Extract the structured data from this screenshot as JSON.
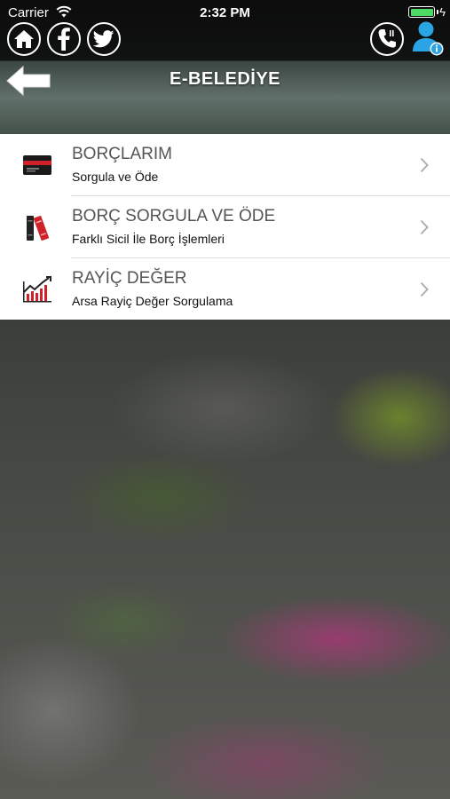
{
  "status_bar": {
    "carrier": "Carrier",
    "time": "2:32 PM"
  },
  "top_icons": {
    "left": [
      "home-icon",
      "facebook-icon",
      "twitter-icon"
    ],
    "right": [
      "phone-icon",
      "user-info-icon"
    ]
  },
  "header": {
    "title": "E-BELEDİYE"
  },
  "menu": {
    "items": [
      {
        "title": "BORÇLARIM",
        "subtitle": "Sorgula ve Öde",
        "icon": "credit-card-icon"
      },
      {
        "title": "BORÇ SORGULA VE ÖDE",
        "subtitle": "Farklı Sicil İle Borç İşlemleri",
        "icon": "books-icon"
      },
      {
        "title": "RAYİÇ DEĞER",
        "subtitle": "Arsa Rayiç Değer Sorgulama",
        "icon": "chart-icon"
      }
    ]
  },
  "colors": {
    "accent_red": "#d0202a",
    "battery_green": "#4cd964",
    "user_icon_blue": "#2aa4e4"
  }
}
